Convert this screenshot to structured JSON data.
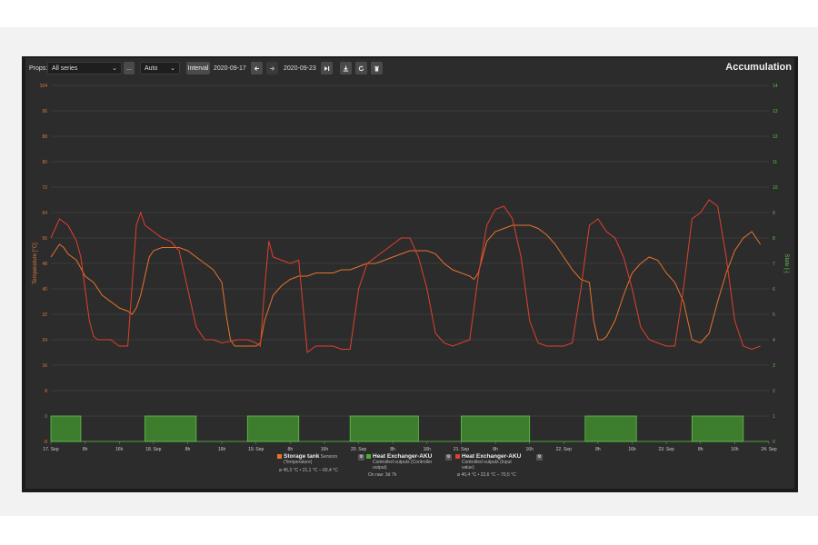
{
  "toolbar": {
    "props_label": "Props:",
    "props_value": "All series",
    "more_label": "...",
    "mode_value": "Auto",
    "interval_label": "Interval",
    "date_from": "2020-09-17",
    "date_to": "2020-09-23",
    "prev_icon": "arrow-left-icon",
    "next_icon": "arrow-right-icon",
    "end_icon": "skip-end-icon",
    "download_icon": "download-icon",
    "refresh_icon": "refresh-icon",
    "delete_icon": "trash-icon"
  },
  "title": "Accumulation",
  "legend": [
    {
      "name": "Storage tank",
      "sub": "Sensors",
      "sub2": "(Temperature)",
      "stats": "ø 45,3 °C • 21,1 °C – 60,4 °C",
      "color": "#e8722c"
    },
    {
      "name": "Heat Exchanger-AKU",
      "sub": "Controlled outputs (Controller",
      "sub2": "output)",
      "stats": "On raw: 3d 7h",
      "color": "#4caf3b"
    },
    {
      "name": "Heat Exchanger-AKU",
      "sub": "Controlled outputs (Input",
      "sub2": "value)",
      "stats": "ø 40,4 °C • 22,6 °C – 70,5 °C",
      "color": "#e0402c"
    }
  ],
  "chart_data": {
    "type": "line",
    "ylabel": "Temperature [°C]",
    "y2label": "State [-]",
    "ylim": [
      -8,
      104
    ],
    "y_ticks": [
      "104",
      "96",
      "88",
      "80",
      "72",
      "64",
      "56",
      "48",
      "40",
      "32",
      "24",
      "16",
      "8",
      "0",
      "-8"
    ],
    "y2lim": [
      0,
      14
    ],
    "y2_ticks": [
      "14",
      "13",
      "12",
      "11",
      "10",
      "9",
      "8",
      "7",
      "6",
      "5",
      "4",
      "3",
      "2",
      "1",
      "0"
    ],
    "x_ticks": [
      "17. Sep",
      "8h",
      "16h",
      "18. Sep",
      "8h",
      "16h",
      "19. Sep",
      "8h",
      "16h",
      "20. Sep",
      "8h",
      "16h",
      "21. Sep",
      "8h",
      "16h",
      "22. Sep",
      "8h",
      "16h",
      "23. Sep",
      "8h",
      "16h",
      "24. Sep"
    ],
    "xlim_hours": [
      0,
      168
    ],
    "grid": true,
    "series": [
      {
        "name": "Storage tank",
        "axis": "left",
        "color": "#e8722c",
        "x": [
          0,
          1,
          2,
          3,
          4,
          6,
          8,
          10,
          12,
          16,
          18,
          19,
          20,
          21,
          22,
          23,
          24,
          26,
          28,
          30,
          32,
          34,
          36,
          38,
          40,
          41,
          42,
          43,
          44,
          46,
          48,
          49,
          50,
          52,
          54,
          56,
          58,
          60,
          62,
          64,
          66,
          68,
          70,
          72,
          74,
          76,
          78,
          80,
          82,
          84,
          86,
          88,
          90,
          92,
          94,
          96,
          98,
          99,
          100,
          101,
          102,
          104,
          106,
          108,
          110,
          112,
          114,
          116,
          118,
          120,
          122,
          124,
          126,
          127,
          128,
          129,
          130,
          132,
          134,
          136,
          138,
          140,
          142,
          144,
          146,
          148,
          150,
          152,
          154,
          156,
          158,
          160,
          162,
          164,
          165,
          166
        ],
        "y": [
          50,
          52,
          54,
          53,
          51,
          49,
          44,
          42,
          38,
          34,
          33,
          32,
          34,
          38,
          44,
          50,
          52,
          53,
          53,
          53,
          52,
          50,
          48,
          46,
          42,
          32,
          24,
          22,
          22,
          22,
          22,
          23,
          30,
          38,
          41,
          43,
          44,
          44,
          45,
          45,
          45,
          46,
          46,
          47,
          48,
          48,
          49,
          50,
          51,
          52,
          52,
          52,
          51,
          48,
          46,
          45,
          44,
          43,
          45,
          50,
          55,
          58,
          59,
          60,
          60,
          60,
          59,
          57,
          54,
          50,
          46,
          43,
          42,
          30,
          24,
          24,
          25,
          30,
          38,
          45,
          48,
          50,
          49,
          45,
          42,
          36,
          24,
          23,
          26,
          36,
          45,
          52,
          56,
          58,
          56,
          54
        ],
        "notes": "approximate"
      },
      {
        "name": "Heat Exchanger-AKU (Input value)",
        "axis": "left",
        "color": "#e0402c",
        "x": [
          0,
          2,
          4,
          6,
          7,
          8,
          9,
          10,
          11,
          12,
          14,
          16,
          18,
          20,
          21,
          22,
          24,
          26,
          28,
          30,
          32,
          34,
          36,
          38,
          40,
          44,
          46,
          48,
          49,
          50,
          51,
          52,
          54,
          56,
          58,
          60,
          62,
          64,
          66,
          68,
          70,
          72,
          74,
          76,
          78,
          80,
          82,
          84,
          86,
          88,
          90,
          92,
          94,
          96,
          98,
          100,
          102,
          104,
          106,
          108,
          110,
          112,
          114,
          116,
          118,
          120,
          122,
          124,
          126,
          128,
          130,
          132,
          134,
          136,
          138,
          140,
          142,
          144,
          146,
          148,
          150,
          152,
          154,
          156,
          158,
          160,
          162,
          164,
          166
        ],
        "y": [
          56,
          62,
          60,
          55,
          50,
          40,
          30,
          25,
          24,
          24,
          24,
          22,
          22,
          60,
          64,
          60,
          58,
          56,
          55,
          52,
          40,
          28,
          24,
          24,
          23,
          24,
          24,
          23,
          22,
          40,
          55,
          50,
          49,
          48,
          49,
          20,
          22,
          22,
          22,
          21,
          21,
          40,
          48,
          50,
          52,
          54,
          56,
          56,
          50,
          40,
          26,
          23,
          22,
          23,
          24,
          44,
          60,
          65,
          66,
          62,
          50,
          30,
          23,
          22,
          22,
          22,
          23,
          40,
          60,
          62,
          58,
          56,
          50,
          40,
          28,
          24,
          23,
          22,
          22,
          40,
          62,
          64,
          68,
          66,
          50,
          30,
          22,
          21,
          22
        ],
        "notes": "approximate"
      },
      {
        "name": "Heat Exchanger-AKU (Controller output)",
        "axis": "right",
        "color": "#4caf3b",
        "type": "step",
        "on_intervals_hours": [
          [
            0,
            7
          ],
          [
            22,
            34
          ],
          [
            46,
            58
          ],
          [
            70,
            86
          ],
          [
            96,
            112
          ],
          [
            125,
            137
          ],
          [
            150,
            162
          ]
        ],
        "on_value": 1,
        "off_value": 0
      }
    ]
  }
}
